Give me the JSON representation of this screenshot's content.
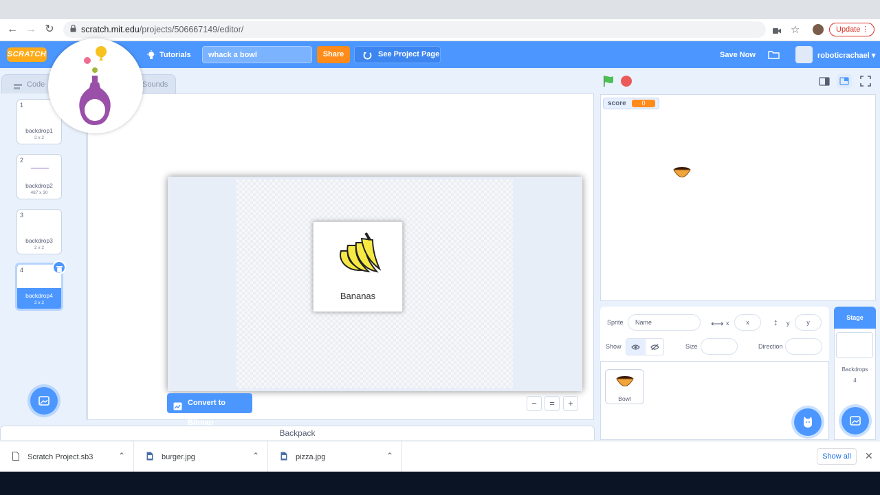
{
  "browser": {
    "url_host": "scratch.mit.edu",
    "url_path": "/projects/506667149/editor/",
    "update_label": "Update"
  },
  "menubar": {
    "logo": "SCRATCH",
    "tutorials_label": "Tutorials",
    "project_title": "whack a bowl",
    "share_label": "Share",
    "see_project_label": "See Project Page",
    "save_now_label": "Save Now",
    "username": "roboticrachael"
  },
  "tabs": {
    "code_label": "Code",
    "sounds_label": "Sounds"
  },
  "costumes": [
    {
      "num": "1",
      "name": "backdrop1",
      "dim": "2 x 2"
    },
    {
      "num": "2",
      "name": "backdrop2",
      "dim": "487 x 30"
    },
    {
      "num": "3",
      "name": "backdrop3",
      "dim": "2 x 2"
    },
    {
      "num": "4",
      "name": "backdrop4",
      "dim": "2 x 2"
    }
  ],
  "canvas": {
    "card_label": "Bananas",
    "convert_label": "Convert to Bitmap"
  },
  "backpack_label": "Backpack",
  "stage": {
    "monitor_label": "score",
    "monitor_value": "0"
  },
  "sprite_info": {
    "sprite_label": "Sprite",
    "name_placeholder": "Name",
    "x_label": "x",
    "x_placeholder": "x",
    "y_label": "y",
    "y_placeholder": "y",
    "show_label": "Show",
    "size_label": "Size",
    "direction_label": "Direction"
  },
  "sprites": [
    {
      "name": "Bowl"
    }
  ],
  "stage_selector": {
    "header": "Stage",
    "backdrops_label": "Backdrops",
    "backdrops_count": "4"
  },
  "downloads": {
    "items": [
      {
        "name": "Scratch Project.sb3"
      },
      {
        "name": "burger.jpg"
      },
      {
        "name": "pizza.jpg"
      }
    ],
    "show_all_label": "Show all"
  },
  "colors": {
    "scratch_blue": "#4c97ff",
    "share_orange": "#ff8c1a",
    "monitor_orange": "#ff8c1a"
  }
}
